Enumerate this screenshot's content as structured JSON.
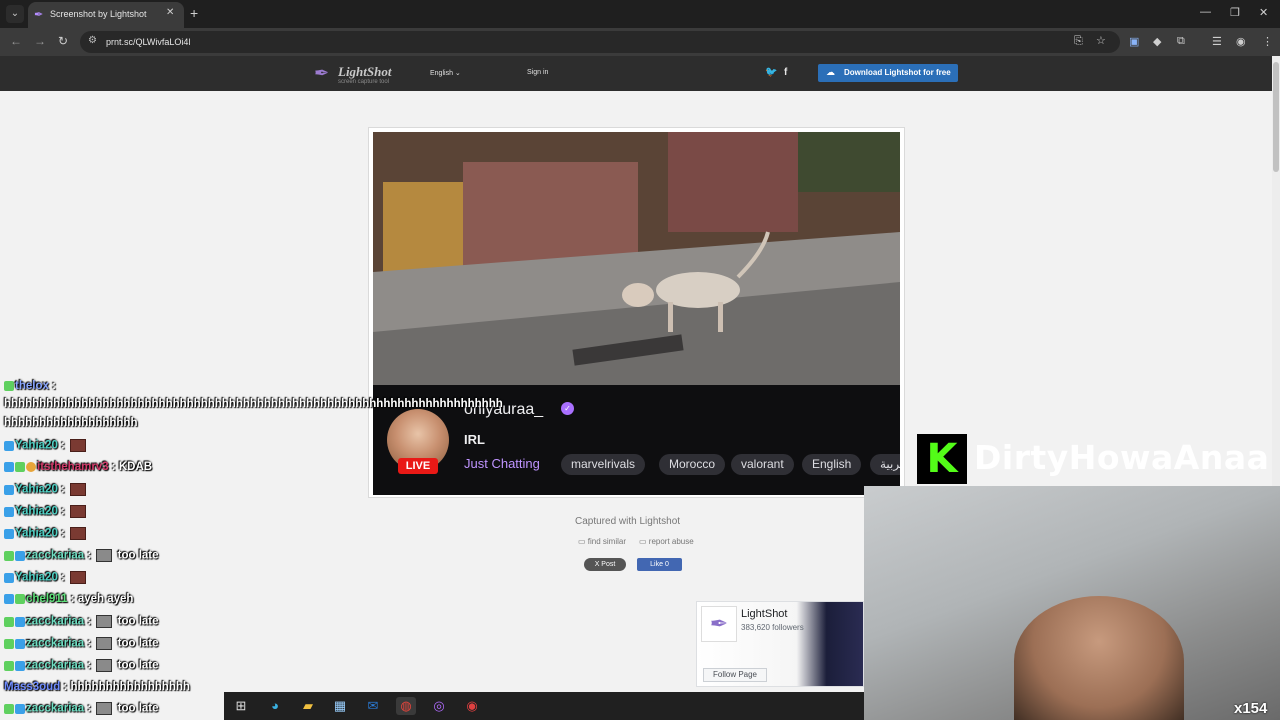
{
  "browser": {
    "tab_title": "Screenshot by Lightshot",
    "url": "prnt.sc/QLWivfaLOi4l"
  },
  "lightshot": {
    "logo": "LightShot",
    "tagline": "screen capture tool",
    "language": "English",
    "sign_in": "Sign in",
    "download": "Download Lightshot for free",
    "captured": "Captured with Lightshot",
    "find_similar": "find similar",
    "report_abuse": "report abuse",
    "x_post": "X Post",
    "fb_like": "Like 0"
  },
  "screenshot": {
    "streamer": "onlyauraa_",
    "live_label": "LIVE",
    "title": "IRL",
    "category": "Just Chatting",
    "tags": [
      "marvelrivals",
      "Morocco",
      "valorant",
      "English",
      "عربية"
    ]
  },
  "fb_widget": {
    "page_name": "LightShot",
    "followers": "383,620 followers",
    "follow_button": "Follow Page"
  },
  "chat": [
    {
      "user": "thelox",
      "color": "#8aa6ff",
      "message": ""
    },
    {
      "user": "",
      "color": "#ffffff",
      "message": "hhhhhhhhhhhhhhhhhhhhhhhhhhhhhhhhhhhhhhhhhhhhhhhhhhhhhhhhhhhhhhhhhhhhhhh"
    },
    {
      "user": "",
      "color": "#ffffff",
      "message": "hhhhhhhhhhhhhhhhhhh"
    },
    {
      "user": "Yahia20",
      "color": "#4fd1c5",
      "message": ""
    },
    {
      "user": "itsthehamrv3",
      "color": "#d23a6a",
      "message": "KDAB"
    },
    {
      "user": "Yahia20",
      "color": "#4fd1c5",
      "message": ""
    },
    {
      "user": "Yahia20",
      "color": "#4fd1c5",
      "message": ""
    },
    {
      "user": "Yahia20",
      "color": "#4fd1c5",
      "message": ""
    },
    {
      "user": "zacckariaa",
      "color": "#6fe0c4",
      "message": "too late"
    },
    {
      "user": "Yahia20",
      "color": "#4fd1c5",
      "message": ""
    },
    {
      "user": "chel911",
      "color": "#5ee07a",
      "message": "ayeh ayeh"
    },
    {
      "user": "zacckariaa",
      "color": "#6fe0c4",
      "message": "too late"
    },
    {
      "user": "zacckariaa",
      "color": "#6fe0c4",
      "message": "too late"
    },
    {
      "user": "zacckariaa",
      "color": "#6fe0c4",
      "message": "too late"
    },
    {
      "user": "Mass3oud",
      "color": "#6f8cff",
      "message": "hhhhhhhhhhhhhhhhh"
    },
    {
      "user": "zacckariaa",
      "color": "#6fe0c4",
      "message": "too late"
    }
  ],
  "overlay": {
    "channel_name": "DirtyHowaAnaa",
    "multiplier": "x154"
  }
}
